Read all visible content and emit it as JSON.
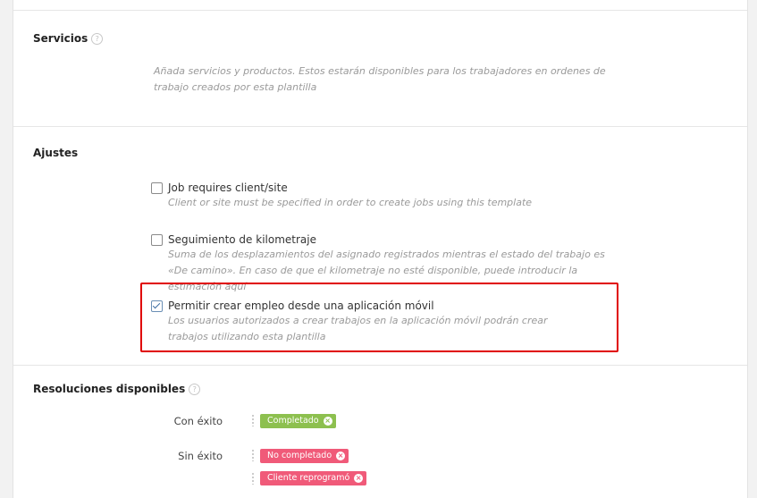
{
  "servicios": {
    "title": "Servicios",
    "help_icon": "?",
    "hint": "Añada servicios y productos. Estos estarán disponibles para los trabajadores en ordenes de trabajo creados por esta plantilla"
  },
  "ajustes": {
    "title": "Ajustes",
    "options": [
      {
        "label": "Job requires client/site",
        "description": "Client or site must be specified in order to create jobs using this template",
        "checked": false
      },
      {
        "label": "Seguimiento de kilometraje",
        "description": "Suma de los desplazamientos del asignado registrados mientras el estado del trabajo es «De camino». En caso de que el kilometraje no esté disponible, puede introducir la estimación aquí",
        "checked": false
      },
      {
        "label": "Permitir crear empleo desde una aplicación móvil",
        "description": "Los usuarios autorizados a crear trabajos en la aplicación móvil podrán crear trabajos utilizando esta plantilla",
        "checked": true
      }
    ]
  },
  "resoluciones": {
    "title": "Resoluciones disponibles",
    "help_icon": "?",
    "success_label": "Con éxito",
    "failure_label": "Sin éxito",
    "success_tags": [
      {
        "label": "Completado",
        "color": "#8dc04f",
        "remove_icon": "×"
      }
    ],
    "failure_tags": [
      {
        "label": "No completado",
        "color": "#f05a79",
        "remove_icon": "×"
      },
      {
        "label": "Cliente reprogramó",
        "color": "#f05a79",
        "remove_icon": "×"
      }
    ]
  },
  "colors": {
    "highlight": "#e00000",
    "checkbox_check": "#3d6ea3"
  }
}
